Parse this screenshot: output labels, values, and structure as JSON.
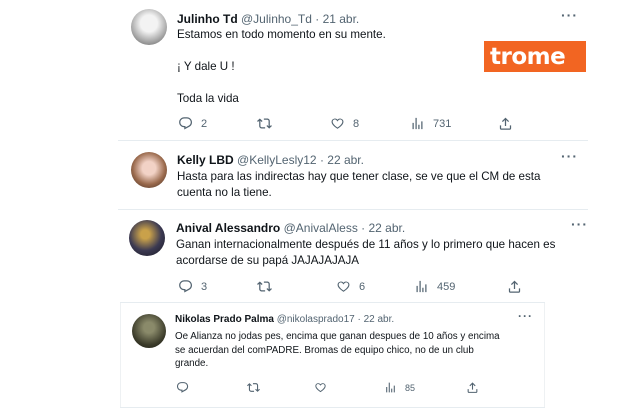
{
  "brand": {
    "logo_text": "trome",
    "color": "#f26522"
  },
  "tweets": [
    {
      "name": "Julinho Td",
      "handle": "@Julinho_Td",
      "date": "· 21 abr.",
      "text": "Estamos en todo momento en su mente.\n\n¡ Y dale U !\n\nToda la vida",
      "replies": "2",
      "retweets": "",
      "likes": "8",
      "views": "731"
    },
    {
      "name": "Kelly LBD",
      "handle": "@KellyLesly12",
      "date": "· 22 abr.",
      "text": "Hasta para las indirectas hay que tener clase, se ve que el CM de esta\ncuenta no la tiene."
    },
    {
      "name": "Anival Alessandro",
      "handle": "@AnivalAless",
      "date": "· 22 abr.",
      "text": "Ganan internacionalmente después de 11 años y lo primero que hacen es\nacordarse de su papá JAJAJAJAJA",
      "replies": "3",
      "retweets": "",
      "likes": "6",
      "views": "459"
    },
    {
      "name": "Nikolas Prado Palma",
      "handle": "@nikolasprado17",
      "date": "· 22 abr.",
      "text": "Oe Alianza no jodas pes, encima que ganan despues de 10 años y encima\nse acuerdan del comPADRE. Bromas de equipo chico, no de un club\ngrande.",
      "replies": "",
      "retweets": "",
      "likes": "",
      "views": "85"
    }
  ],
  "icons": {
    "more": "more-icon",
    "reply": "reply-icon",
    "retweet": "retweet-icon",
    "like": "like-icon",
    "views": "views-icon",
    "share": "share-icon"
  }
}
